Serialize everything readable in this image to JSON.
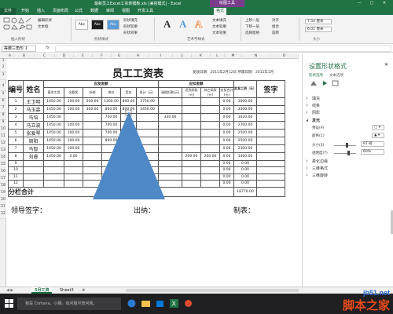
{
  "window": {
    "title": "最新员工Excel工资表模板.xls [兼容模式] - Excel",
    "context_tab": "绘图工具",
    "accent": "#217346",
    "context_color": "#7c3c8c"
  },
  "tabs": [
    "文件",
    "开始",
    "插入",
    "页面布局",
    "公式",
    "数据",
    "审阅",
    "视图",
    "开发工具",
    "格式"
  ],
  "ribbon": {
    "insert_shapes_label": "插入形状",
    "edit_shape": "编辑形状",
    "text_box": "文本框",
    "shape_styles_label": "形状样式",
    "style_sample": "Abc",
    "shape_fill": "形状填充",
    "shape_outline": "形状轮廓",
    "shape_effects": "形状效果",
    "wordart_label": "艺术字样式",
    "wordart_letter": "A",
    "text_fill": "文本填充",
    "text_outline": "文本轮廓",
    "text_effects": "文本效果",
    "arrange": [
      "上移一层",
      "下移一层",
      "选择窗格"
    ],
    "arrange_right": [
      "对齐",
      "组合",
      "旋转"
    ],
    "height": "7.54 厘米",
    "width": "6.01 厘米",
    "size_label": "大小"
  },
  "formula_bar": {
    "name_box": "等腰三角形 1",
    "fx": "fx"
  },
  "columns": [
    "A",
    "B",
    "C",
    "D",
    "E",
    "F",
    "G",
    "H",
    "I",
    "J",
    "K",
    "L",
    "M",
    "N",
    "O"
  ],
  "rows": [
    "1",
    "2",
    "3",
    "4",
    "5",
    "6",
    "7",
    "8",
    "9",
    "10",
    "11",
    "12",
    "13",
    "14",
    "15",
    "16",
    "17",
    "18",
    "19",
    "20",
    "21",
    "22"
  ],
  "sheet": {
    "title": "员工工资表",
    "issue_date": "发放日期：2015年2月12日  所属日期：2015年1月",
    "col_seq": "编号",
    "col_name": "姓名",
    "payable_group": "应发金额",
    "deduct_group": "应扣金额",
    "net_header": "实发工资（元）",
    "sign_header": "签字",
    "payable_cols": [
      "基本工资",
      "全勤奖",
      "补助",
      "岗位",
      "奖金",
      "合计（元）"
    ],
    "deduct_cols": [
      "请假扣款(元)",
      "迟到扣款(元)",
      "其它扣款(元)",
      "应扣合计(元)"
    ],
    "rows": [
      {
        "no": "1",
        "name": "王卫明",
        "base": "1450.00",
        "att": "100.00",
        "sub": "200.00",
        "post": "1200.00",
        "bonus": "800.00",
        "total": "3750.00",
        "leave": "",
        "late": "",
        "other": "",
        "dtotal": "0.00",
        "net": "3500.00"
      },
      {
        "no": "2",
        "name": "马玉森",
        "base": "1450.00",
        "att": "100.00",
        "sub": "300.00",
        "post": "800.00",
        "bonus": "800.00",
        "total": "3450.00",
        "leave": "",
        "late": "",
        "other": "",
        "dtotal": "0.00",
        "net": "3300.00"
      },
      {
        "no": "3",
        "name": "马培",
        "base": "1450.00",
        "att": "",
        "sub": "",
        "post": "700.00",
        "bonus": "",
        "total": "",
        "leave": "330.00",
        "late": "",
        "other": "",
        "dtotal": "0.00",
        "net": "1620.00"
      },
      {
        "no": "4",
        "name": "马立波",
        "base": "1450.00",
        "att": "100.00",
        "sub": "",
        "post": "700.00",
        "bonus": "",
        "total": "",
        "leave": "",
        "late": "",
        "other": "",
        "dtotal": "0.00",
        "net": "2700.00"
      },
      {
        "no": "5",
        "name": "张爱琴",
        "base": "1450.00",
        "att": "100.00",
        "sub": "",
        "post": "700.00",
        "bonus": "",
        "total": "",
        "leave": "",
        "late": "",
        "other": "",
        "dtotal": "0.00",
        "net": "2500.00"
      },
      {
        "no": "6",
        "name": "周阳",
        "base": "1450.00",
        "att": "100.00",
        "sub": "",
        "post": "800.00",
        "bonus": "",
        "total": "",
        "leave": "",
        "late": "",
        "other": "",
        "dtotal": "0.00",
        "net": "2500.00"
      },
      {
        "no": "7",
        "name": "马智",
        "base": "1450.00",
        "att": "100.00",
        "sub": "",
        "post": "",
        "bonus": "",
        "total": "",
        "leave": "",
        "late": "",
        "other": "",
        "dtotal": "0.00",
        "net": "2300.00"
      },
      {
        "no": "8",
        "name": "刘睿",
        "base": "1450.00",
        "att": "0.00",
        "sub": "",
        "post": "",
        "bonus": "",
        "total": "",
        "leave": "",
        "late": "200.00",
        "other": "200.00",
        "dtotal": "0.00",
        "net": "1400.00"
      },
      {
        "no": "9",
        "name": "",
        "base": "",
        "att": "",
        "sub": "",
        "post": "",
        "bonus": "",
        "total": "",
        "leave": "",
        "late": "",
        "other": "",
        "dtotal": "0.00",
        "net": "0.00"
      },
      {
        "no": "10",
        "name": "",
        "base": "",
        "att": "",
        "sub": "",
        "post": "",
        "bonus": "",
        "total": "",
        "leave": "",
        "late": "",
        "other": "",
        "dtotal": "0.00",
        "net": "0.00"
      },
      {
        "no": "11",
        "name": "",
        "base": "",
        "att": "",
        "sub": "",
        "post": "",
        "bonus": "",
        "total": "",
        "leave": "",
        "late": "",
        "other": "",
        "dtotal": "0.00",
        "net": "0.00"
      },
      {
        "no": "12",
        "name": "",
        "base": "",
        "att": "",
        "sub": "",
        "post": "",
        "bonus": "",
        "total": "",
        "leave": "",
        "late": "",
        "other": "",
        "dtotal": "0.00",
        "net": "0.00"
      }
    ],
    "subtotal_label": "分栏合计",
    "subtotal_net": "18770.00",
    "leader_sign": "领导签字：",
    "cashier": "出纳：",
    "maker": "制表："
  },
  "pane": {
    "title": "设置形状格式",
    "tab_shape": "形状选项",
    "tab_text": "文本选项",
    "sections": [
      "填充",
      "线条",
      "阴影",
      "发光",
      "柔化边缘",
      "三维格式",
      "三维旋转"
    ],
    "preset_label": "预设(P)",
    "color_label": "颜色(C)",
    "size_label": "大小(S)",
    "size_value": "87 磅",
    "transparency_label": "透明度(T)",
    "transparency_value": "60%",
    "size_fraction": 0.55,
    "transparency_fraction": 0.6
  },
  "sheet_tabs": [
    "5月工资",
    "Sheet3"
  ],
  "taskbar": {
    "search_text": "我是 Cortana，小娜。有问题尽管问我。"
  },
  "watermark": {
    "url": "jb51.net",
    "cn": "脚本之家"
  },
  "shape_color": "#4f88c6"
}
